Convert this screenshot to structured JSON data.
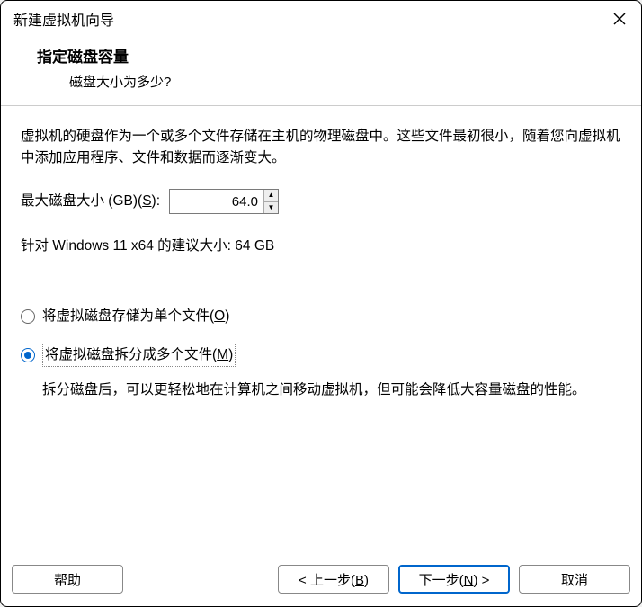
{
  "window": {
    "title": "新建虚拟机向导"
  },
  "header": {
    "heading": "指定磁盘容量",
    "subheading": "磁盘大小为多少?"
  },
  "content": {
    "intro": "虚拟机的硬盘作为一个或多个文件存储在主机的物理磁盘中。这些文件最初很小，随着您向虚拟机中添加应用程序、文件和数据而逐渐变大。",
    "diskSizeLabelPrefix": "最大磁盘大小 (GB)(",
    "diskSizeLabelKey": "S",
    "diskSizeLabelSuffix": "):",
    "diskSizeValue": "64.0",
    "recommendation": "针对 Windows 11 x64 的建议大小: 64 GB",
    "radio": {
      "singleFilePrefix": "将虚拟磁盘存储为单个文件(",
      "singleFileKey": "O",
      "singleFileSuffix": ")",
      "splitFilePrefix": "将虚拟磁盘拆分成多个文件(",
      "splitFileKey": "M",
      "splitFileSuffix": ")",
      "splitDesc": "拆分磁盘后，可以更轻松地在计算机之间移动虚拟机，但可能会降低大容量磁盘的性能。"
    }
  },
  "footer": {
    "help": "帮助",
    "backPrefix": "< 上一步(",
    "backKey": "B",
    "backSuffix": ")",
    "nextPrefix": "下一步(",
    "nextKey": "N",
    "nextSuffix": ") >",
    "cancel": "取消"
  }
}
